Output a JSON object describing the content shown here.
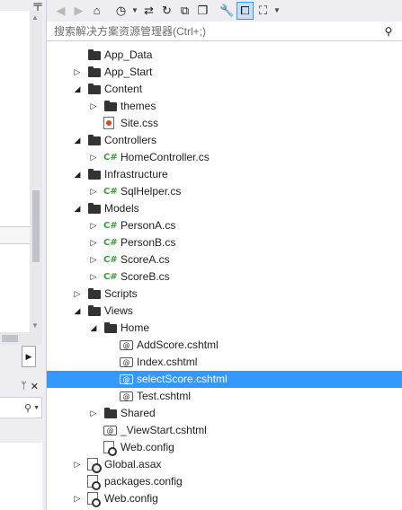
{
  "toolbar": {
    "icons": [
      "back-icon",
      "forward-icon",
      "home-icon",
      "history-icon",
      "dropdown-caret",
      "sync-icon",
      "refresh-icon",
      "collapse-all-icon",
      "show-all-files-icon",
      "properties-icon",
      "preview-icon",
      "view-class-diagram-icon",
      "dropdown-caret"
    ]
  },
  "search": {
    "placeholder": "搜索解决方案资源管理器(Ctrl+;)",
    "icon": "search-icon"
  },
  "left_panel": {
    "pin_glyph": "ᛘ",
    "close_glyph": "✕",
    "search_glyph": "⚲"
  },
  "tree": {
    "items": [
      {
        "label": "App_Data",
        "depth": 1,
        "expander": "",
        "icon": "folder-icon"
      },
      {
        "label": "App_Start",
        "depth": 1,
        "expander": "collapsed",
        "icon": "folder-icon"
      },
      {
        "label": "Content",
        "depth": 1,
        "expander": "expanded",
        "icon": "folder-open-icon"
      },
      {
        "label": "themes",
        "depth": 2,
        "expander": "collapsed",
        "icon": "folder-icon"
      },
      {
        "label": "Site.css",
        "depth": 2,
        "expander": "",
        "icon": "css-file-icon"
      },
      {
        "label": "Controllers",
        "depth": 1,
        "expander": "expanded",
        "icon": "folder-open-icon"
      },
      {
        "label": "HomeController.cs",
        "depth": 2,
        "expander": "collapsed",
        "icon": "csharp-file-icon"
      },
      {
        "label": "Infrastructure",
        "depth": 1,
        "expander": "expanded",
        "icon": "folder-open-icon"
      },
      {
        "label": "SqlHelper.cs",
        "depth": 2,
        "expander": "collapsed",
        "icon": "csharp-file-icon"
      },
      {
        "label": "Models",
        "depth": 1,
        "expander": "expanded",
        "icon": "folder-open-icon"
      },
      {
        "label": "PersonA.cs",
        "depth": 2,
        "expander": "collapsed",
        "icon": "csharp-file-icon"
      },
      {
        "label": "PersonB.cs",
        "depth": 2,
        "expander": "collapsed",
        "icon": "csharp-file-icon"
      },
      {
        "label": "ScoreA.cs",
        "depth": 2,
        "expander": "collapsed",
        "icon": "csharp-file-icon"
      },
      {
        "label": "ScoreB.cs",
        "depth": 2,
        "expander": "collapsed",
        "icon": "csharp-file-icon"
      },
      {
        "label": "Scripts",
        "depth": 1,
        "expander": "collapsed",
        "icon": "folder-icon"
      },
      {
        "label": "Views",
        "depth": 1,
        "expander": "expanded",
        "icon": "folder-open-icon"
      },
      {
        "label": "Home",
        "depth": 2,
        "expander": "expanded",
        "icon": "folder-open-icon"
      },
      {
        "label": "AddScore.cshtml",
        "depth": 3,
        "expander": "",
        "icon": "razor-file-icon"
      },
      {
        "label": "Index.cshtml",
        "depth": 3,
        "expander": "",
        "icon": "razor-file-icon"
      },
      {
        "label": "selectScore.cshtml",
        "depth": 3,
        "expander": "",
        "icon": "razor-file-icon",
        "selected": true
      },
      {
        "label": "Test.cshtml",
        "depth": 3,
        "expander": "",
        "icon": "razor-file-icon"
      },
      {
        "label": "Shared",
        "depth": 2,
        "expander": "collapsed",
        "icon": "folder-icon"
      },
      {
        "label": "_ViewStart.cshtml",
        "depth": 2,
        "expander": "",
        "icon": "razor-file-icon"
      },
      {
        "label": "Web.config",
        "depth": 2,
        "expander": "",
        "icon": "config-file-icon"
      },
      {
        "label": "Global.asax",
        "depth": 1,
        "expander": "collapsed",
        "icon": "global-asax-icon"
      },
      {
        "label": "packages.config",
        "depth": 1,
        "expander": "",
        "icon": "config-file-icon"
      },
      {
        "label": "Web.config",
        "depth": 1,
        "expander": "collapsed",
        "icon": "config-file-icon"
      }
    ]
  },
  "colors": {
    "selection": "#3399ff",
    "toolbar_bg": "#eeeef2",
    "csharp_glyph": "#3aa03a"
  }
}
